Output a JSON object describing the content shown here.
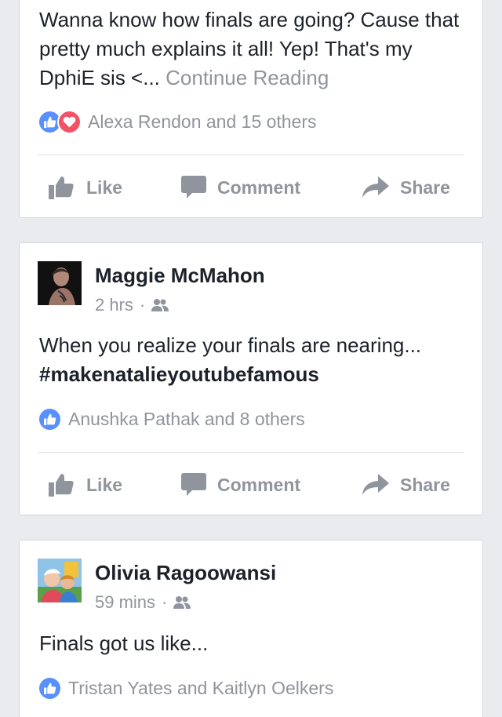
{
  "posts": [
    {
      "text": "Wanna know how finals are going? Cause that pretty much explains it all! Yep! That's my DphiE sis <...",
      "more_label": "Continue Reading",
      "reactions_text": "Alexa Rendon and 15 others",
      "actions": {
        "like": "Like",
        "comment": "Comment",
        "share": "Share"
      }
    },
    {
      "author": "Maggie McMahon",
      "time": "2 hrs",
      "meta_sep": "·",
      "text": "When you realize your finals are nearing...",
      "hashtag": "#makenatalieyoutubefamous",
      "reactions_text": "Anushka Pathak and 8 others",
      "actions": {
        "like": "Like",
        "comment": "Comment",
        "share": "Share"
      }
    },
    {
      "author": "Olivia Ragoowansi",
      "time": "59 mins",
      "meta_sep": "·",
      "text": "Finals got us like...",
      "reactions_text": "Tristan Yates and Kaitlyn Oelkers"
    }
  ],
  "icons": {
    "like_reaction": "thumbs-up-icon",
    "love_reaction": "heart-icon",
    "audience": "friends-icon",
    "like_action": "thumbs-up-icon",
    "comment_action": "speech-bubble-icon",
    "share_action": "share-arrow-icon"
  },
  "colors": {
    "like_blue": "#5890ff",
    "love_red": "#f25268",
    "muted_text": "#90949c",
    "body_text": "#1d2129",
    "background": "#e9ebee"
  }
}
